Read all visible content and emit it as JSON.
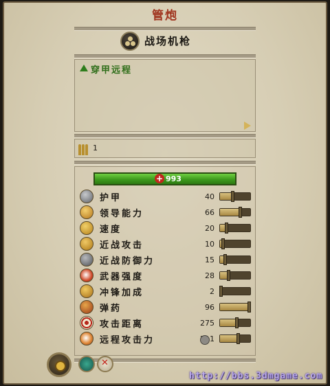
{
  "title": "管炮",
  "unit": {
    "name": "战场机枪",
    "icon": "cannonball-stack-icon"
  },
  "ability": {
    "label": "穿甲远程",
    "more_arrow_icon": "arrow-right-icon"
  },
  "ammo": {
    "icon": "ammo-bundle-icon",
    "count": "1"
  },
  "health": {
    "icon": "red-cross-icon",
    "value": "993"
  },
  "stats": [
    {
      "id": "armor",
      "label": "护甲",
      "value": "40",
      "icon": "armor-icon",
      "level": 0.4
    },
    {
      "id": "leadership",
      "label": "领导能力",
      "value": "66",
      "icon": "leadership-icon",
      "level": 0.66
    },
    {
      "id": "speed",
      "label": "速度",
      "value": "20",
      "icon": "speed-arrow-icon",
      "level": 0.2
    },
    {
      "id": "melee-attack",
      "label": "近战攻击",
      "value": "10",
      "icon": "melee-attack-icon",
      "level": 0.1
    },
    {
      "id": "melee-defense",
      "label": "近战防御力",
      "value": "15",
      "icon": "melee-defense-icon",
      "level": 0.15
    },
    {
      "id": "weapon-strength",
      "label": "武器强度",
      "value": "28",
      "icon": "weapon-strength-icon",
      "level": 0.28
    },
    {
      "id": "charge-bonus",
      "label": "冲锋加成",
      "value": "2",
      "icon": "charge-bonus-icon",
      "level": 0.02
    },
    {
      "id": "ammunition",
      "label": "弹药",
      "value": "96",
      "icon": "ammunition-icon",
      "level": 0.96
    },
    {
      "id": "range",
      "label": "攻击距离",
      "value": "275",
      "icon": "range-target-icon",
      "level": 0.55
    },
    {
      "id": "missile-strength",
      "label": "远程攻击力",
      "value": "211",
      "icon": "missile-strength-icon",
      "level": 0.6
    }
  ],
  "extra_icon": "ability-ring-icon",
  "buttons": {
    "main": "unit-portrait-button",
    "a": "guard-mode-button",
    "b": "disband-button"
  },
  "watermark": "http://bbs.3dmgame.com"
}
